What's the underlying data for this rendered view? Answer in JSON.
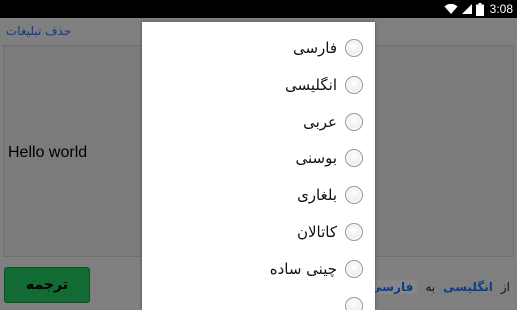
{
  "status_bar": {
    "time": "3:08",
    "icons": [
      "wifi-icon",
      "signal-icon",
      "battery-icon"
    ]
  },
  "app": {
    "remove_ads_label": "حذف تبلیغات",
    "source_text": "Hello world",
    "translate_button_label": "ترجمه",
    "language_row": {
      "from_label": "از",
      "from_language": "انگلیسی",
      "to_label": "به",
      "to_language": "فارسی"
    }
  },
  "dialog": {
    "options": [
      {
        "label": "فارسی"
      },
      {
        "label": "انگلیسی"
      },
      {
        "label": "عربی"
      },
      {
        "label": "بوسنی"
      },
      {
        "label": "بلغاری"
      },
      {
        "label": "کاتالان"
      },
      {
        "label": "چینی ساده"
      }
    ]
  },
  "colors": {
    "status_bar_bg": "#000000",
    "app_dim_bg": "#7f7f7f",
    "link_blue": "#0a3d8a",
    "translate_button": "#126b32",
    "dialog_bg": "#ffffff"
  }
}
